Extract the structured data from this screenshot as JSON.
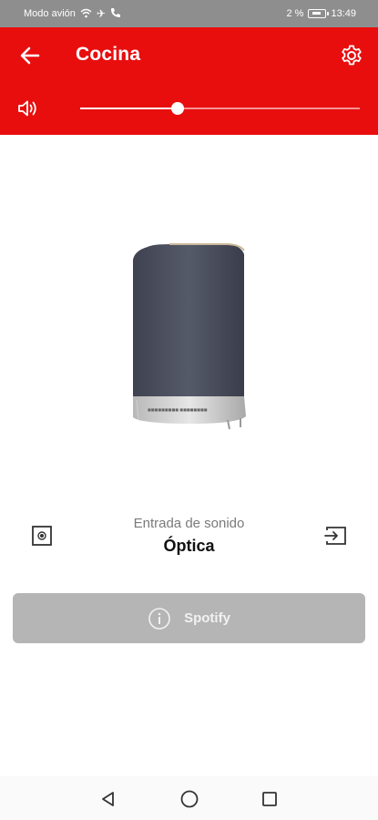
{
  "status_bar": {
    "airplane_text": "Modo avión",
    "battery_percent": "2 %",
    "time": "13:49"
  },
  "header": {
    "title": "Cocina",
    "back_icon": "arrow-left-icon",
    "settings_icon": "gear-icon"
  },
  "volume": {
    "icon": "speaker-volume-icon",
    "level": 0.35
  },
  "source": {
    "label": "Entrada de sonido",
    "value": "Óptica",
    "prev_icon": "optical-input-icon",
    "next_icon": "input-switch-icon"
  },
  "spotify_button": {
    "label": "Spotify",
    "icon": "info-circle-icon"
  },
  "nav": {
    "back_icon": "nav-back-triangle-icon",
    "home_icon": "nav-home-circle-icon",
    "recents_icon": "nav-recents-square-icon"
  },
  "colors": {
    "brand_red": "#e80e0e",
    "status_gray": "#8e8e8e",
    "button_gray": "#b5b5b5"
  }
}
